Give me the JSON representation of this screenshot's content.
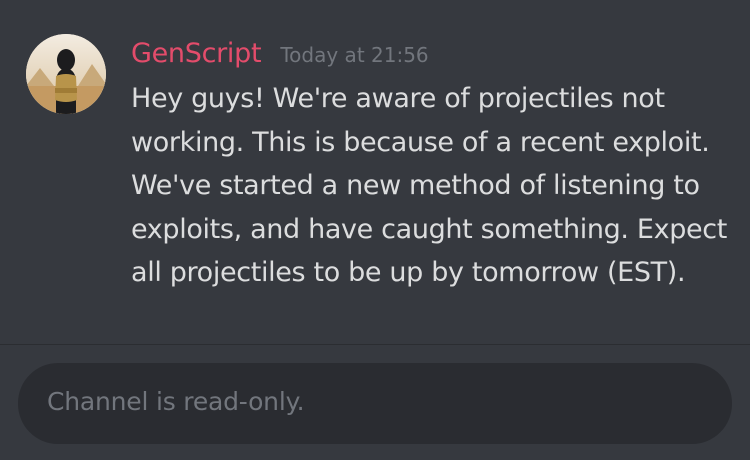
{
  "message": {
    "username": "GenScript",
    "timestamp": "Today at 21:56",
    "lines": [
      "Hey guys! We're aware of projectiles not",
      "working. This is because of a recent exploit.",
      "We've started a new method of listening to",
      "exploits, and have caught something. Expect",
      "all projectiles to be up by tomorrow (EST)."
    ],
    "avatar_icon": "user-avatar-hooded-figure",
    "username_color": "#e34c6b"
  },
  "composer": {
    "placeholder": "Channel is read-only."
  },
  "colors": {
    "background": "#36393f",
    "composer_background": "#2a2c31",
    "text": "#dcddde",
    "muted": "#72767d"
  }
}
